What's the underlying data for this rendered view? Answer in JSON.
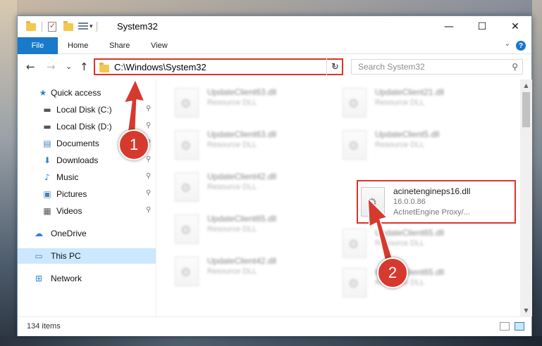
{
  "window": {
    "title": "System32",
    "controls": {
      "minimize": "—",
      "maximize": "☐",
      "close": "✕"
    }
  },
  "ribbon": {
    "file": "File",
    "tabs": [
      "Home",
      "Share",
      "View"
    ],
    "help": "?"
  },
  "navigation": {
    "back": "←",
    "forward": "→",
    "recent": "⌄",
    "up": "↑",
    "address": "C:\\Windows\\System32",
    "refresh": "↻",
    "search_placeholder": "Search System32",
    "search_icon": "⚲"
  },
  "sidebar": {
    "items": [
      {
        "label": "Quick access",
        "icon": "★",
        "icon_color": "#2f7fd6",
        "pinned": false
      },
      {
        "label": "Local Disk (C:)",
        "icon": "▬",
        "icon_color": "#555555",
        "pinned": true
      },
      {
        "label": "Local Disk (D:)",
        "icon": "▬",
        "icon_color": "#555555",
        "pinned": true
      },
      {
        "label": "Documents",
        "icon": "▤",
        "icon_color": "#4a7fb5",
        "pinned": true
      },
      {
        "label": "Downloads",
        "icon": "⬇",
        "icon_color": "#2f7fd6",
        "pinned": true
      },
      {
        "label": "Music",
        "icon": "♪",
        "icon_color": "#2f7fd6",
        "pinned": true
      },
      {
        "label": "Pictures",
        "icon": "▣",
        "icon_color": "#4a7fb5",
        "pinned": true
      },
      {
        "label": "Videos",
        "icon": "▦",
        "icon_color": "#555555",
        "pinned": true
      },
      {
        "label": "OneDrive",
        "icon": "☁",
        "icon_color": "#2f7fd6",
        "pinned": false
      },
      {
        "label": "This PC",
        "icon": "▭",
        "icon_color": "#4a7fb5",
        "pinned": false,
        "selected": true
      },
      {
        "label": "Network",
        "icon": "⊞",
        "icon_color": "#2f7fd6",
        "pinned": false
      }
    ],
    "pin_glyph": "⚲"
  },
  "files": [
    {
      "name": "UpdateClient63.dll",
      "type": "Resource DLL"
    },
    {
      "name": "UpdateClient21.dll",
      "type": "Resource DLL"
    },
    {
      "name": "UpdateClient63.dll",
      "type": "Resource DLL"
    },
    {
      "name": "UpdateClient5.dll",
      "type": "Resource DLL"
    },
    {
      "name": "UpdateClient42.dll",
      "type": "Resource DLL"
    },
    {
      "name": "acinetengineps16.dll",
      "version": "16.0.0.86",
      "description": "AcInetEngine Proxy/...",
      "highlighted": true
    },
    {
      "name": "UpdateClient65.dll",
      "type": "Resource DLL"
    },
    {
      "name": "UpdateClient65.dll",
      "type": "Resource DLL"
    },
    {
      "name": "UpdateClient42.dll",
      "type": "Resource DLL"
    },
    {
      "name": "UpdateClient65.dll",
      "type": "Resource DLL"
    }
  ],
  "scrollbar": {
    "up": "▲",
    "down": "▼"
  },
  "status": {
    "item_count": "134 items"
  },
  "annotations": [
    {
      "label": "1",
      "color": "#d63a2f"
    },
    {
      "label": "2",
      "color": "#d63a2f"
    }
  ],
  "accent_color": "#1979ca",
  "highlight_color": "#d9342b"
}
